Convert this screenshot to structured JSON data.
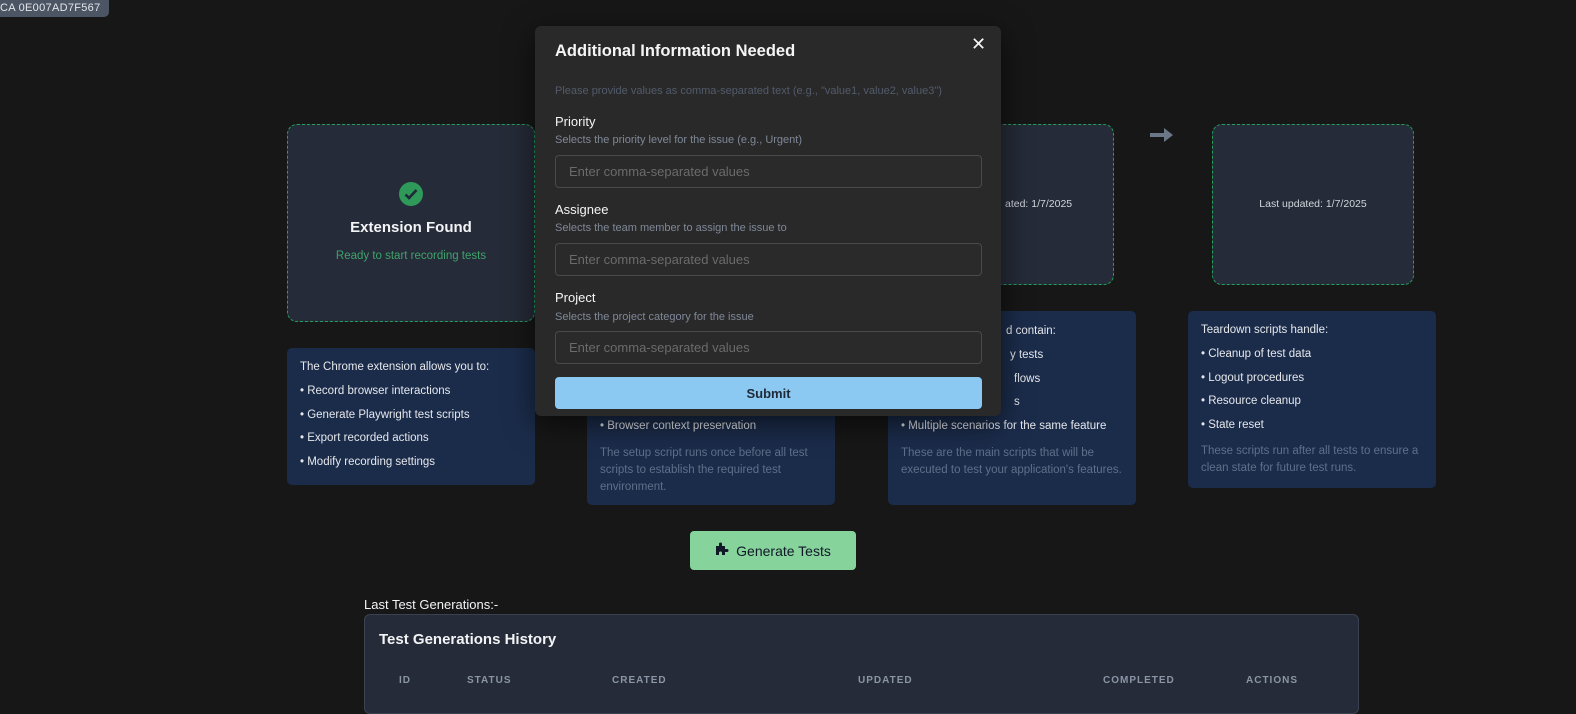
{
  "id_badge": "CA 0E007AD7F567",
  "stages": {
    "extension": {
      "title": "Extension Found",
      "subtitle": "Ready to start recording tests",
      "status_color": "#2e9958"
    },
    "tests": {
      "updated_fragment": "ated: 1/7/2025"
    },
    "teardown": {
      "updated": "Last updated: 1/7/2025"
    }
  },
  "info": {
    "extension": {
      "heading": "The Chrome extension allows you to:",
      "items": [
        "• Record browser interactions",
        "• Generate Playwright test scripts",
        "• Export recorded actions",
        "• Modify recording settings"
      ]
    },
    "setup": {
      "items": [
        "• Browser context preservation"
      ],
      "description": "The setup script runs once before all test scripts to establish the required test environment."
    },
    "tests": {
      "heading_fragment": "d contain:",
      "item_fragments": [
        "y tests",
        "flows",
        "s"
      ],
      "items": [
        "• Multiple scenarios for the same feature"
      ],
      "description": "These are the main scripts that will be executed to test your application's features."
    },
    "teardown": {
      "heading": "Teardown scripts handle:",
      "items": [
        "• Cleanup of test data",
        "• Logout procedures",
        "• Resource cleanup",
        "• State reset"
      ],
      "description": "These scripts run after all tests to ensure a clean state for future test runs."
    }
  },
  "generate_button": {
    "label": "Generate Tests",
    "icon": "puzzle-icon",
    "color": "#86d39c"
  },
  "last_generations_label": "Last Test Generations:-",
  "history": {
    "title": "Test Generations History",
    "columns": [
      "ID",
      "STATUS",
      "CREATED",
      "UPDATED",
      "COMPLETED",
      "ACTIONS"
    ]
  },
  "modal": {
    "title": "Additional Information Needed",
    "close_icon": "close-icon",
    "hint": "Please provide values as comma-separated text (e.g., \"value1, value2, value3\")",
    "fields": [
      {
        "label": "Priority",
        "description": "Selects the priority level for the issue (e.g., Urgent)",
        "value": "",
        "placeholder": "Enter comma-separated values"
      },
      {
        "label": "Assignee",
        "description": "Selects the team member to assign the issue to",
        "value": "",
        "placeholder": "Enter comma-separated values"
      },
      {
        "label": "Project",
        "description": "Selects the project category for the issue",
        "value": "",
        "placeholder": "Enter comma-separated values"
      }
    ],
    "submit_label": "Submit",
    "submit_color": "#8bc9f2"
  }
}
